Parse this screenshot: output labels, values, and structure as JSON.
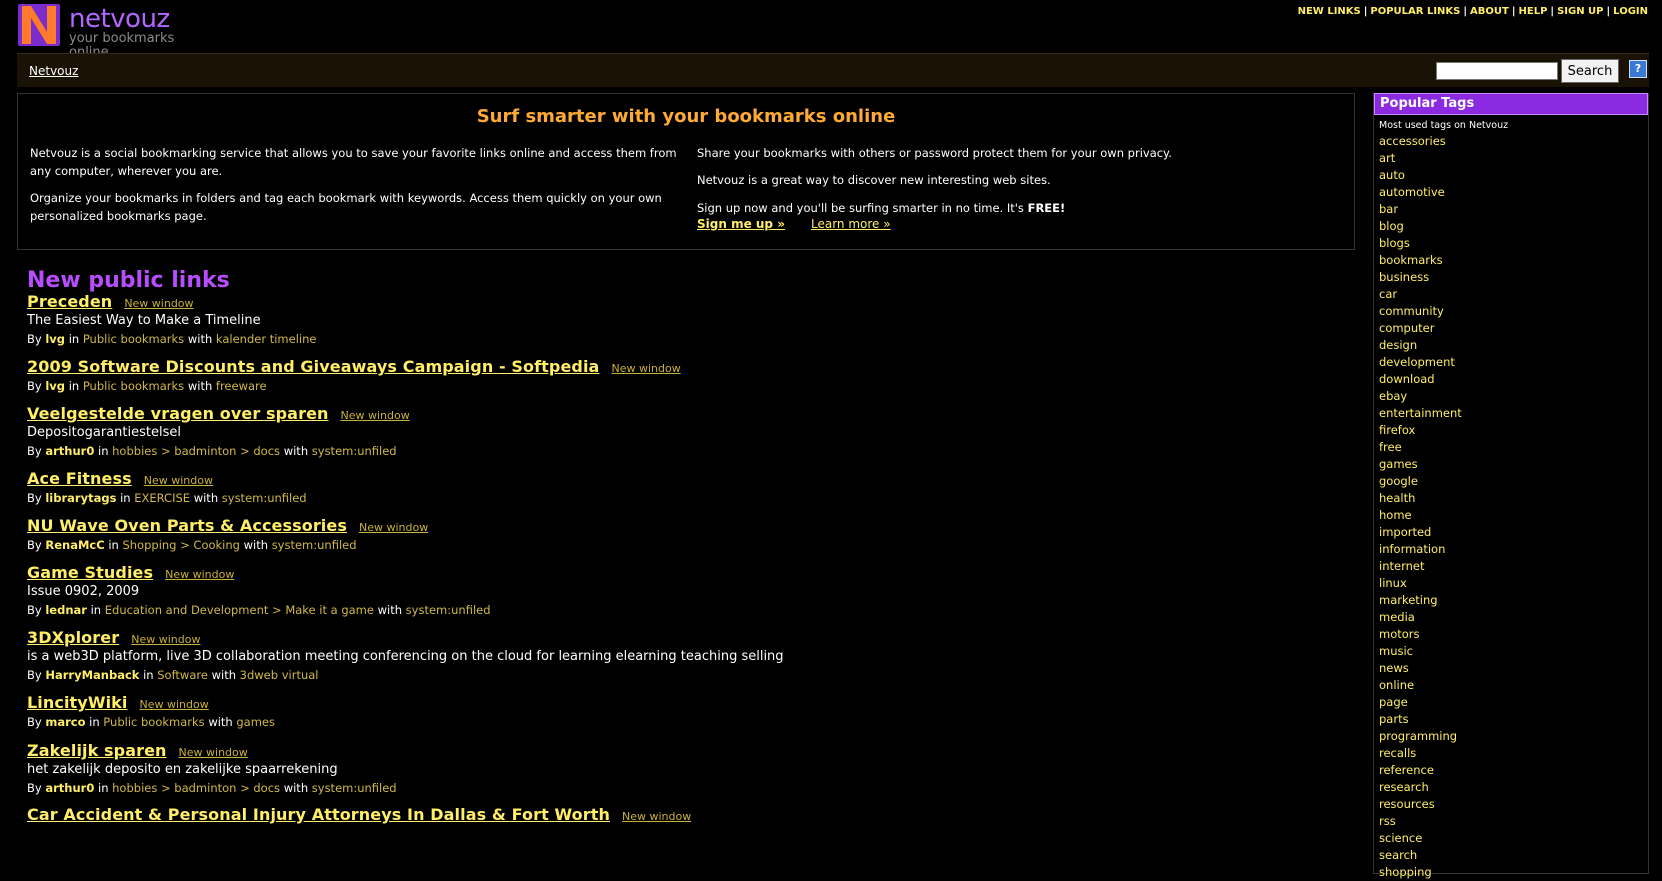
{
  "logo": {
    "name": "netvouz",
    "tagline": "your bookmarks online"
  },
  "top_nav": [
    "NEW LINKS",
    "POPULAR LINKS",
    "ABOUT",
    "HELP",
    "SIGN UP",
    "LOGIN"
  ],
  "breadcrumb": "Netvouz",
  "search": {
    "value": "",
    "button_label": "Search",
    "help_icon": "help-icon"
  },
  "intro": {
    "title": "Surf smarter with your bookmarks online",
    "left": [
      "Netvouz is a social bookmarking service that allows you to save your favorite links online and access them from any computer, wherever you are.",
      "Organize your bookmarks in folders and tag each bookmark with keywords. Access them quickly on your own personalized bookmarks page."
    ],
    "right": [
      "Share your bookmarks with others or password protect them for your own privacy.",
      "Netvouz is a great way to discover new interesting web sites.",
      "Sign up now and you'll be surfing smarter in no time. It's"
    ],
    "free": "FREE!",
    "signup_link": "Sign me up »",
    "learn_link": "Learn more »"
  },
  "links_heading": "New public links",
  "new_window_label": "New window",
  "by_label": "By",
  "in_label": "in",
  "with_label": "with",
  "links": [
    {
      "title": "Preceden",
      "desc": "The Easiest Way to Make a Timeline",
      "user": "lvg",
      "folder": "Public bookmarks",
      "tags": "kalender timeline"
    },
    {
      "title": "2009 Software Discounts and Giveaways Campaign - Softpedia",
      "desc": "",
      "user": "lvg",
      "folder": "Public bookmarks",
      "tags": "freeware"
    },
    {
      "title": "Veelgestelde vragen over sparen",
      "desc": "Depositogarantiestelsel",
      "user": "arthur0",
      "folder": "hobbies > badminton > docs",
      "tags": "system:unfiled"
    },
    {
      "title": "Ace Fitness",
      "desc": "",
      "user": "librarytags",
      "folder": "EXERCISE",
      "tags": "system:unfiled"
    },
    {
      "title": "NU Wave Oven Parts & Accessories",
      "desc": "",
      "user": "RenaMcC",
      "folder": "Shopping > Cooking",
      "tags": "system:unfiled"
    },
    {
      "title": "Game Studies",
      "desc": "Issue 0902, 2009",
      "user": "lednar",
      "folder": "Education and Development > Make it a game",
      "tags": "system:unfiled"
    },
    {
      "title": "3DXplorer",
      "desc": "is a web3D platform, live 3D collaboration meeting conferencing on the cloud for learning elearning teaching selling",
      "user": "HarryManback",
      "folder": "Software",
      "tags": "3dweb virtual"
    },
    {
      "title": "LincityWiki",
      "desc": "",
      "user": "marco",
      "folder": "Public bookmarks",
      "tags": "games"
    },
    {
      "title": "Zakelijk sparen",
      "desc": "het zakelijk deposito en zakelijke spaarrekening",
      "user": "arthur0",
      "folder": "hobbies > badminton > docs",
      "tags": "system:unfiled"
    },
    {
      "title": "Car Accident & Personal Injury Attorneys In Dallas & Fort Worth",
      "desc": "",
      "user": "",
      "folder": "",
      "tags": ""
    }
  ],
  "sidebar": {
    "title": "Popular Tags",
    "subtitle": "Most used tags on Netvouz",
    "tags": [
      "accessories",
      "art",
      "auto",
      "automotive",
      "bar",
      "blog",
      "blogs",
      "bookmarks",
      "business",
      "car",
      "community",
      "computer",
      "design",
      "development",
      "download",
      "ebay",
      "entertainment",
      "firefox",
      "free",
      "games",
      "google",
      "health",
      "home",
      "imported",
      "information",
      "internet",
      "linux",
      "marketing",
      "media",
      "motors",
      "music",
      "news",
      "online",
      "page",
      "parts",
      "programming",
      "recalls",
      "reference",
      "research",
      "resources",
      "rss",
      "science",
      "search",
      "shopping"
    ]
  },
  "colors": {
    "accent_purple": "#8a2be2",
    "heading_purple": "#b84dff",
    "link_yellow": "#ffee66",
    "title_orange": "#ffaa33",
    "background": "#000000"
  }
}
